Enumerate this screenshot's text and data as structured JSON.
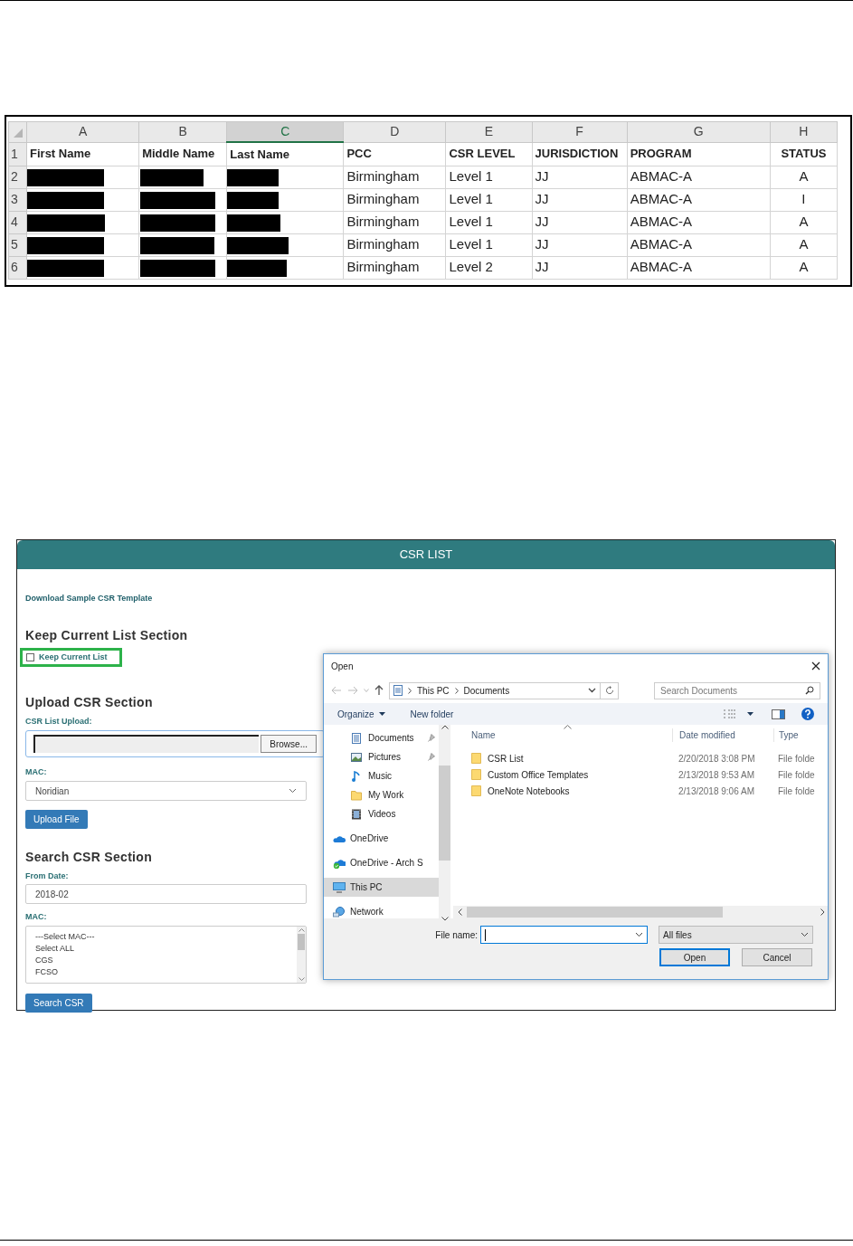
{
  "spreadsheet": {
    "columns": [
      {
        "letter": "A",
        "selected": false
      },
      {
        "letter": "B",
        "selected": false
      },
      {
        "letter": "C",
        "selected": true
      },
      {
        "letter": "D",
        "selected": false
      },
      {
        "letter": "E",
        "selected": false
      },
      {
        "letter": "F",
        "selected": false
      },
      {
        "letter": "G",
        "selected": false
      },
      {
        "letter": "H",
        "selected": false
      }
    ],
    "rows": [
      {
        "number": "1",
        "kind": "header",
        "cells": [
          {
            "text": "First Name"
          },
          {
            "text": "Middle Name"
          },
          {
            "text": "Last Name"
          },
          {
            "text": "PCC"
          },
          {
            "text": "CSR LEVEL"
          },
          {
            "text": "JURISDICTION"
          },
          {
            "text": "PROGRAM"
          },
          {
            "text": "STATUS"
          }
        ]
      },
      {
        "number": "2",
        "kind": "data",
        "cells": [
          {
            "redacted": true
          },
          {
            "redacted": true
          },
          {
            "redacted": true
          },
          {
            "text": "Birmingham"
          },
          {
            "text": "Level 1"
          },
          {
            "text": "JJ"
          },
          {
            "text": "ABMAC-A"
          },
          {
            "text": "A"
          }
        ]
      },
      {
        "number": "3",
        "kind": "data",
        "cells": [
          {
            "redacted": true
          },
          {
            "redacted": true
          },
          {
            "redacted": true
          },
          {
            "text": "Birmingham"
          },
          {
            "text": "Level 1"
          },
          {
            "text": "JJ"
          },
          {
            "text": "ABMAC-A"
          },
          {
            "text": "I"
          }
        ]
      },
      {
        "number": "4",
        "kind": "data",
        "cells": [
          {
            "redacted": true
          },
          {
            "redacted": true
          },
          {
            "redacted": true
          },
          {
            "text": "Birmingham"
          },
          {
            "text": "Level 1"
          },
          {
            "text": "JJ"
          },
          {
            "text": "ABMAC-A"
          },
          {
            "text": "A"
          }
        ]
      },
      {
        "number": "5",
        "kind": "data",
        "cells": [
          {
            "redacted": true
          },
          {
            "redacted": true
          },
          {
            "redacted": true
          },
          {
            "text": "Birmingham"
          },
          {
            "text": "Level 1"
          },
          {
            "text": "JJ"
          },
          {
            "text": "ABMAC-A"
          },
          {
            "text": "A"
          }
        ]
      },
      {
        "number": "6",
        "kind": "data",
        "cells": [
          {
            "redacted": true
          },
          {
            "redacted": true
          },
          {
            "redacted": true
          },
          {
            "text": "Birmingham"
          },
          {
            "text": "Level 2"
          },
          {
            "text": "JJ"
          },
          {
            "text": "ABMAC-A"
          },
          {
            "text": "A"
          }
        ]
      }
    ]
  },
  "csr_app": {
    "title": "CSR LIST",
    "template_link": "Download Sample CSR Template",
    "keep_section": {
      "heading": "Keep Current List Section",
      "checkbox": {
        "label": "Keep Current List",
        "checked": false
      }
    },
    "upload_section": {
      "heading": "Upload CSR Section",
      "file_label": "CSR List Upload:",
      "browse_button": "Browse...",
      "mac_label": "MAC:",
      "mac_value": "Noridian",
      "upload_button": "Upload File"
    },
    "search_section": {
      "heading": "Search CSR Section",
      "date_label": "From Date:",
      "date_value": "2018-02",
      "mac_label": "MAC:",
      "mac_options": [
        "---Select MAC---",
        "Select ALL",
        "CGS",
        "FCSO"
      ],
      "search_button": "Search CSR"
    }
  },
  "open_dialog": {
    "title": "Open",
    "breadcrumbs": [
      "This PC",
      "Documents"
    ],
    "search": {
      "placeholder": "Search Documents"
    },
    "toolbar": {
      "organize": "Organize",
      "new_folder": "New folder"
    },
    "nav_items": [
      {
        "label": "Documents",
        "kind": "documents",
        "pinned": true,
        "selected": false
      },
      {
        "label": "Pictures",
        "kind": "pictures",
        "pinned": true,
        "selected": false
      },
      {
        "label": "Music",
        "kind": "music",
        "pinned": false,
        "selected": false
      },
      {
        "label": "My Work",
        "kind": "folder",
        "pinned": false,
        "selected": false
      },
      {
        "label": "Videos",
        "kind": "videos",
        "pinned": false,
        "selected": false
      },
      {
        "label": "OneDrive",
        "kind": "cloud",
        "pinned": false,
        "selected": false
      },
      {
        "label": "OneDrive - Arch S",
        "kind": "cloud-synced",
        "pinned": false,
        "selected": false
      },
      {
        "label": "This PC",
        "kind": "pc",
        "pinned": false,
        "selected": true
      },
      {
        "label": "Network",
        "kind": "network",
        "pinned": false,
        "selected": false
      }
    ],
    "columns": [
      "Name",
      "Date modified",
      "Type"
    ],
    "files": [
      {
        "name": "CSR List",
        "date": "2/20/2018 3:08 PM",
        "type": "File folde"
      },
      {
        "name": "Custom Office Templates",
        "date": "2/13/2018 9:53 AM",
        "type": "File folde"
      },
      {
        "name": "OneNote Notebooks",
        "date": "2/13/2018 9:06 AM",
        "type": "File folde"
      }
    ],
    "file_name_label": "File name:",
    "file_type": "All files",
    "buttons": [
      "Open",
      "Cancel"
    ]
  }
}
